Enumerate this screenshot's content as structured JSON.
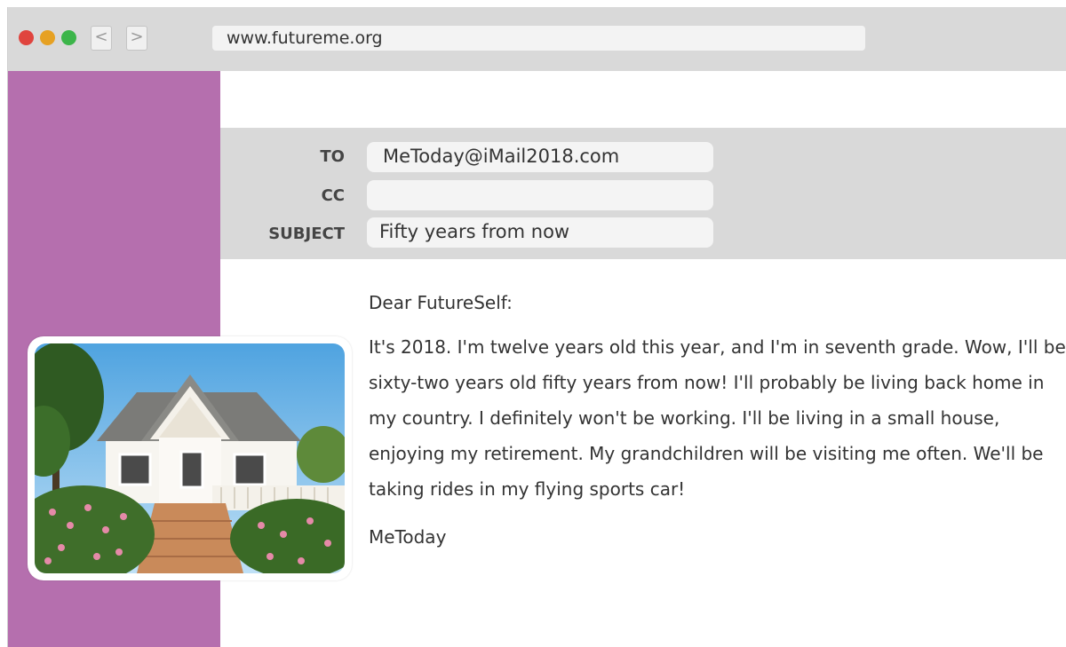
{
  "browser": {
    "url": "www.futureme.org",
    "back_glyph": "<",
    "forward_glyph": ">",
    "traffic_colors": [
      "#e0443e",
      "#e6a123",
      "#3cb54a"
    ]
  },
  "theme": {
    "sidebar_color": "#b56fae",
    "header_band_color": "#d9d9d9"
  },
  "email": {
    "to_label": "TO",
    "to_value": "MeToday@iMail2018.com",
    "cc_label": "CC",
    "cc_value": "",
    "subject_label": "SUBJECT",
    "subject_value": "Fifty years from now"
  },
  "letter": {
    "salutation": "Dear FutureSelf:",
    "body": "It's 2018. I'm twelve years old this year, and I'm in seventh grade. Wow, I'll be sixty-two years old fifty years from now! I'll probably be living back home in my country. I definitely won't be working. I'll be living in a small house, enjoying my retirement. My grandchildren will be visiting me often. We'll be taking rides in my flying sports car!",
    "signature": "MeToday"
  }
}
